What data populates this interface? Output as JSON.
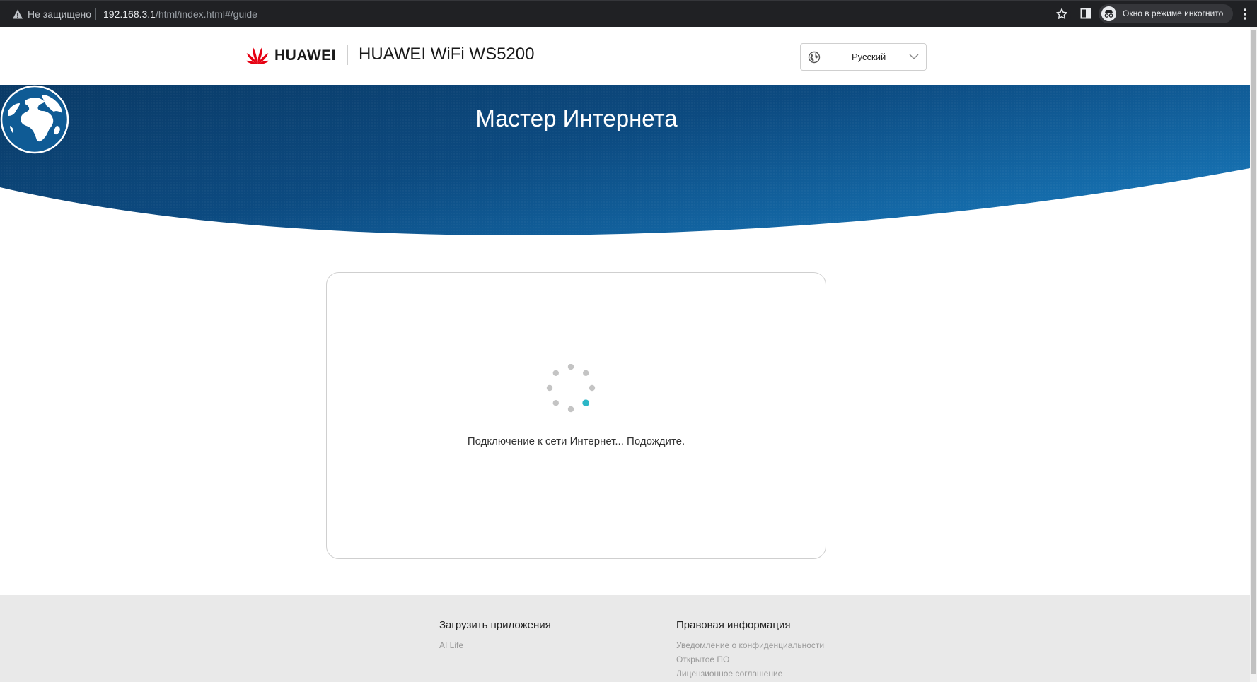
{
  "browser": {
    "security_label": "Не защищено",
    "url_host": "192.168.3.1",
    "url_path": "/html/index.html#/guide",
    "incognito_label": "Окно в режиме инкогнито"
  },
  "header": {
    "brand": "HUAWEI",
    "product_name": "HUAWEI WiFi WS5200",
    "language": "Русский"
  },
  "banner": {
    "title": "Мастер Интернета"
  },
  "wizard": {
    "status": "Подключение к сети Интернет... Подождите."
  },
  "footer": {
    "apps_heading": "Загрузить приложения",
    "apps_links": [
      "AI Life"
    ],
    "legal_heading": "Правовая информация",
    "legal_links": [
      "Уведомление о конфиденциальности",
      "Открытое ПО",
      "Лицензионное соглашение"
    ]
  },
  "colors": {
    "banner_dark": "#0a3f6e",
    "banner_light": "#1568a8",
    "spinner_active": "#2cb7c7",
    "spinner_idle": "#c4c4c4",
    "huawei_red": "#e60012"
  }
}
